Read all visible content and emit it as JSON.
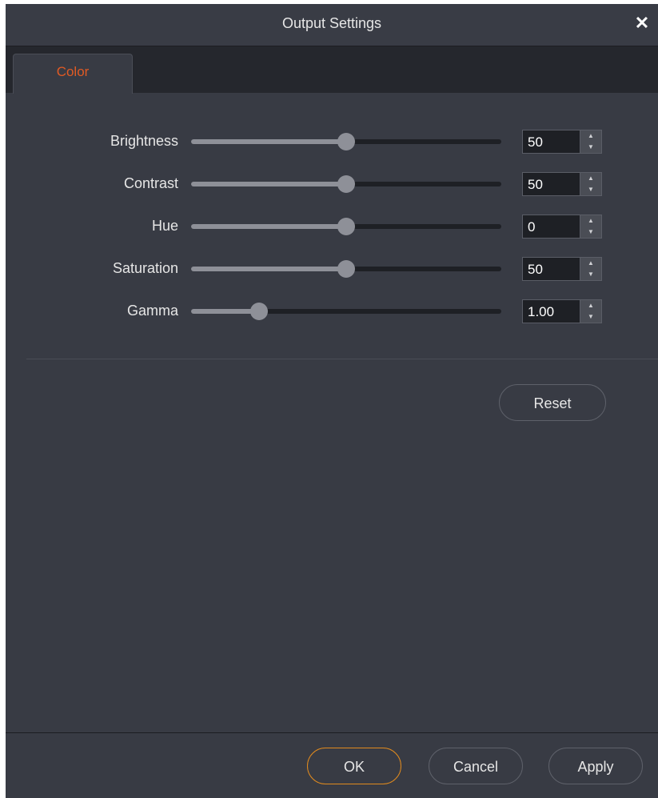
{
  "window": {
    "title": "Output Settings"
  },
  "tabs": [
    {
      "label": "Color",
      "active": true
    }
  ],
  "sliders": [
    {
      "label": "Brightness",
      "value": "50",
      "level": 0.5
    },
    {
      "label": "Contrast",
      "value": "50",
      "level": 0.5
    },
    {
      "label": "Hue",
      "value": "0",
      "level": 0.5
    },
    {
      "label": "Saturation",
      "value": "50",
      "level": 0.5
    },
    {
      "label": "Gamma",
      "value": "1.00",
      "level": 0.22
    }
  ],
  "buttons": {
    "reset": "Reset",
    "ok": "OK",
    "cancel": "Cancel",
    "apply": "Apply"
  },
  "colors": {
    "background": "#383b44",
    "accent_tab": "#e05a24",
    "ok_border": "#e08a1e"
  }
}
